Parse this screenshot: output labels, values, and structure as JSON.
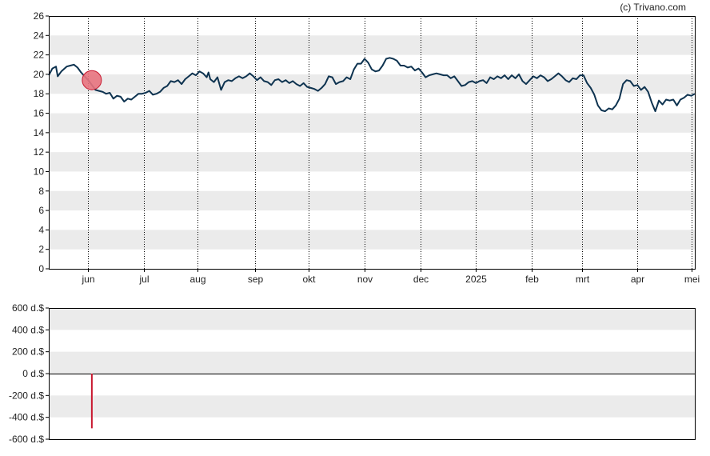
{
  "credit": "(c) Trivano.com",
  "colors": {
    "price_line": "#0e3350",
    "band": "#ebebeb",
    "marker_fill": "#e8737e",
    "marker_stroke": "#c8182f",
    "insider_bar": "#c8182f",
    "axis": "#000000"
  },
  "chart_data": [
    {
      "type": "line",
      "ylim": [
        0,
        26
      ],
      "yticks": [
        "0",
        "2",
        "4",
        "6",
        "8",
        "10",
        "12",
        "14",
        "16",
        "18",
        "20",
        "22",
        "24",
        "26"
      ],
      "month_ticks": [
        "jun",
        "jul",
        "aug",
        "sep",
        "okt",
        "nov",
        "dec",
        "2025",
        "feb",
        "mrt",
        "apr",
        "mei"
      ],
      "month_tick_day": [
        22,
        53,
        83,
        115,
        145,
        176,
        207,
        238,
        269,
        297,
        328,
        358
      ],
      "xlim_days": [
        0,
        360
      ],
      "grid": "alternating horizontal bands, dotted vertical lines at month ticks",
      "series": [
        {
          "points": [
            [
              0,
              19.9
            ],
            [
              2,
              20.6
            ],
            [
              4,
              20.8
            ],
            [
              5,
              19.8
            ],
            [
              7,
              20.3
            ],
            [
              10,
              20.8
            ],
            [
              12,
              20.9
            ],
            [
              14,
              21.0
            ],
            [
              16,
              20.7
            ],
            [
              18,
              20.2
            ],
            [
              20,
              19.8
            ],
            [
              22,
              19.4
            ],
            [
              24,
              18.9
            ],
            [
              26,
              18.4
            ],
            [
              28,
              18.3
            ],
            [
              30,
              18.2
            ],
            [
              32,
              18.0
            ],
            [
              34,
              18.1
            ],
            [
              36,
              17.5
            ],
            [
              38,
              17.8
            ],
            [
              40,
              17.7
            ],
            [
              42,
              17.2
            ],
            [
              44,
              17.5
            ],
            [
              46,
              17.4
            ],
            [
              48,
              17.7
            ],
            [
              50,
              18.0
            ],
            [
              52,
              18.0
            ],
            [
              54,
              18.1
            ],
            [
              56,
              18.3
            ],
            [
              58,
              17.9
            ],
            [
              60,
              18.0
            ],
            [
              62,
              18.2
            ],
            [
              64,
              18.6
            ],
            [
              66,
              18.8
            ],
            [
              68,
              19.3
            ],
            [
              70,
              19.2
            ],
            [
              72,
              19.4
            ],
            [
              74,
              19.0
            ],
            [
              76,
              19.5
            ],
            [
              78,
              19.8
            ],
            [
              80,
              20.1
            ],
            [
              82,
              19.9
            ],
            [
              84,
              20.3
            ],
            [
              86,
              20.1
            ],
            [
              88,
              19.7
            ],
            [
              89,
              20.2
            ],
            [
              90,
              19.5
            ],
            [
              92,
              19.2
            ],
            [
              94,
              19.7
            ],
            [
              96,
              18.4
            ],
            [
              98,
              19.2
            ],
            [
              100,
              19.4
            ],
            [
              102,
              19.3
            ],
            [
              104,
              19.6
            ],
            [
              106,
              19.8
            ],
            [
              108,
              19.6
            ],
            [
              110,
              19.8
            ],
            [
              112,
              20.1
            ],
            [
              114,
              19.8
            ],
            [
              116,
              19.4
            ],
            [
              118,
              19.7
            ],
            [
              120,
              19.3
            ],
            [
              122,
              19.2
            ],
            [
              124,
              18.9
            ],
            [
              126,
              19.4
            ],
            [
              128,
              19.5
            ],
            [
              130,
              19.2
            ],
            [
              132,
              19.4
            ],
            [
              134,
              19.1
            ],
            [
              136,
              19.3
            ],
            [
              138,
              19.0
            ],
            [
              140,
              18.8
            ],
            [
              142,
              19.1
            ],
            [
              144,
              18.7
            ],
            [
              146,
              18.6
            ],
            [
              148,
              18.5
            ],
            [
              150,
              18.3
            ],
            [
              152,
              18.6
            ],
            [
              154,
              19.0
            ],
            [
              156,
              19.8
            ],
            [
              158,
              19.7
            ],
            [
              160,
              19.0
            ],
            [
              162,
              19.2
            ],
            [
              164,
              19.3
            ],
            [
              166,
              19.7
            ],
            [
              168,
              19.5
            ],
            [
              170,
              20.5
            ],
            [
              172,
              21.1
            ],
            [
              174,
              21.1
            ],
            [
              176,
              21.6
            ],
            [
              178,
              21.2
            ],
            [
              180,
              20.5
            ],
            [
              182,
              20.3
            ],
            [
              184,
              20.4
            ],
            [
              186,
              20.9
            ],
            [
              188,
              21.6
            ],
            [
              190,
              21.7
            ],
            [
              192,
              21.6
            ],
            [
              194,
              21.4
            ],
            [
              196,
              20.9
            ],
            [
              198,
              20.9
            ],
            [
              200,
              20.7
            ],
            [
              202,
              20.8
            ],
            [
              204,
              20.4
            ],
            [
              206,
              20.6
            ],
            [
              208,
              20.2
            ],
            [
              210,
              19.7
            ],
            [
              212,
              19.9
            ],
            [
              214,
              20.0
            ],
            [
              216,
              20.1
            ],
            [
              218,
              20.0
            ],
            [
              220,
              19.9
            ],
            [
              222,
              19.9
            ],
            [
              224,
              19.6
            ],
            [
              226,
              19.8
            ],
            [
              228,
              19.3
            ],
            [
              230,
              18.8
            ],
            [
              232,
              18.9
            ],
            [
              234,
              19.2
            ],
            [
              236,
              19.3
            ],
            [
              238,
              19.1
            ],
            [
              240,
              19.3
            ],
            [
              242,
              19.4
            ],
            [
              244,
              19.1
            ],
            [
              246,
              19.7
            ],
            [
              248,
              19.5
            ],
            [
              250,
              19.8
            ],
            [
              252,
              19.6
            ],
            [
              254,
              19.9
            ],
            [
              256,
              19.5
            ],
            [
              258,
              19.9
            ],
            [
              260,
              19.6
            ],
            [
              262,
              20.0
            ],
            [
              264,
              19.3
            ],
            [
              266,
              19.0
            ],
            [
              268,
              19.4
            ],
            [
              270,
              19.8
            ],
            [
              272,
              19.6
            ],
            [
              274,
              19.9
            ],
            [
              276,
              19.7
            ],
            [
              278,
              19.3
            ],
            [
              280,
              19.5
            ],
            [
              282,
              19.8
            ],
            [
              284,
              20.1
            ],
            [
              286,
              19.8
            ],
            [
              288,
              19.4
            ],
            [
              290,
              19.2
            ],
            [
              292,
              19.6
            ],
            [
              294,
              19.5
            ],
            [
              296,
              19.9
            ],
            [
              298,
              19.9
            ],
            [
              300,
              19.1
            ],
            [
              302,
              18.6
            ],
            [
              304,
              17.9
            ],
            [
              306,
              16.8
            ],
            [
              308,
              16.3
            ],
            [
              310,
              16.2
            ],
            [
              312,
              16.5
            ],
            [
              314,
              16.4
            ],
            [
              316,
              16.8
            ],
            [
              318,
              17.5
            ],
            [
              320,
              19.0
            ],
            [
              322,
              19.4
            ],
            [
              324,
              19.3
            ],
            [
              326,
              18.8
            ],
            [
              328,
              18.9
            ],
            [
              330,
              18.4
            ],
            [
              332,
              18.7
            ],
            [
              334,
              18.2
            ],
            [
              336,
              17.1
            ],
            [
              338,
              16.2
            ],
            [
              340,
              17.3
            ],
            [
              342,
              16.9
            ],
            [
              344,
              17.4
            ],
            [
              346,
              17.3
            ],
            [
              348,
              17.4
            ],
            [
              350,
              16.8
            ],
            [
              352,
              17.4
            ],
            [
              354,
              17.6
            ],
            [
              356,
              17.9
            ],
            [
              358,
              17.8
            ],
            [
              360,
              18.0
            ]
          ]
        }
      ],
      "markers": [
        {
          "day": 24,
          "value": 19.4
        }
      ]
    },
    {
      "type": "bar",
      "ylim": [
        -600,
        600
      ],
      "yticks": [
        "600 d.$",
        "400 d.$",
        "200 d.$",
        "0 d.$",
        "-200 d.$",
        "-400 d.$",
        "-600 d.$"
      ],
      "xlim_days": [
        0,
        360
      ],
      "grid": "alternating horizontal bands",
      "bars": [
        {
          "day": 24,
          "value": -500
        }
      ]
    }
  ]
}
